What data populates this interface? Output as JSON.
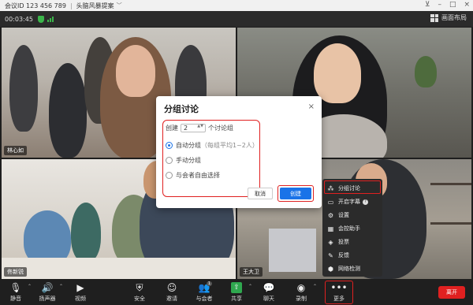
{
  "titlebar": {
    "meeting_id": "会议ID 123 456 789",
    "separator": "|",
    "meeting_title": "头脑风暴提案",
    "caret": "﹀"
  },
  "status": {
    "elapsed": "00:03:45",
    "layout_label": "画面布局"
  },
  "participants": {
    "p1_name": "林心如",
    "p3_name": "佟新锐",
    "p4_name": "王大卫"
  },
  "dialog": {
    "title": "分组讨论",
    "close": "×",
    "create_prefix": "创建",
    "group_count": "2",
    "stepper_arrows": "▲▼",
    "create_suffix": "个讨论组",
    "option_auto": "自动分组",
    "option_auto_hint": "（每组平均1~2人）",
    "option_manual": "手动分组",
    "option_free": "与会者自由选择",
    "selected_option": "自动分组",
    "cancel": "取消",
    "create": "创建"
  },
  "more_menu": {
    "items": [
      {
        "label": "分组讨论",
        "icon": "breakout-icon"
      },
      {
        "label": "开启字幕",
        "icon": "caption-icon"
      },
      {
        "label": "设置",
        "icon": "settings-icon"
      },
      {
        "label": "会控助手",
        "icon": "assistant-icon"
      },
      {
        "label": "投票",
        "icon": "vote-icon"
      },
      {
        "label": "反馈",
        "icon": "feedback-icon"
      },
      {
        "label": "网络检测",
        "icon": "network-icon"
      }
    ],
    "help_glyph": "?"
  },
  "toolbar": {
    "mute": "静音",
    "speaker": "扬声器",
    "video": "视频",
    "security": "安全",
    "invite": "邀请",
    "participants": "与会者",
    "participants_count": "1",
    "share": "共享",
    "chat": "聊天",
    "record": "录制",
    "more": "更多",
    "leave": "离开"
  },
  "colors": {
    "accent_blue": "#1a73e8",
    "leave_red": "#e02020",
    "annotation_red": "#e02020",
    "secure_green": "#3bb54a"
  }
}
